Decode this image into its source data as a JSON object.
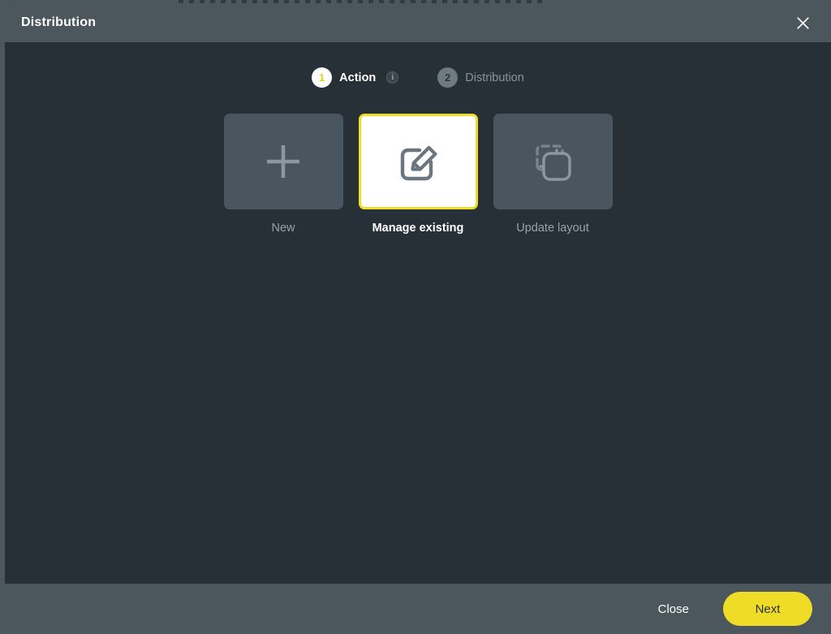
{
  "dialog": {
    "title": "Distribution",
    "close_icon": "close-icon"
  },
  "stepper": {
    "steps": [
      {
        "number": "1",
        "label": "Action",
        "state": "active",
        "info_icon": "i"
      },
      {
        "number": "2",
        "label": "Distribution",
        "state": "inactive"
      }
    ]
  },
  "options": {
    "items": [
      {
        "label": "New",
        "icon": "plus-icon",
        "selected": false
      },
      {
        "label": "Manage existing",
        "icon": "edit-square-icon",
        "selected": true
      },
      {
        "label": "Update layout",
        "icon": "duplicate-layout-icon",
        "selected": false
      }
    ]
  },
  "footer": {
    "close_label": "Close",
    "next_label": "Next"
  },
  "colors": {
    "accent": "#eedc27",
    "titlebar": "#4b565d",
    "body": "#272f37",
    "tile": "#4a565f",
    "muted_text": "#99a2a9"
  }
}
